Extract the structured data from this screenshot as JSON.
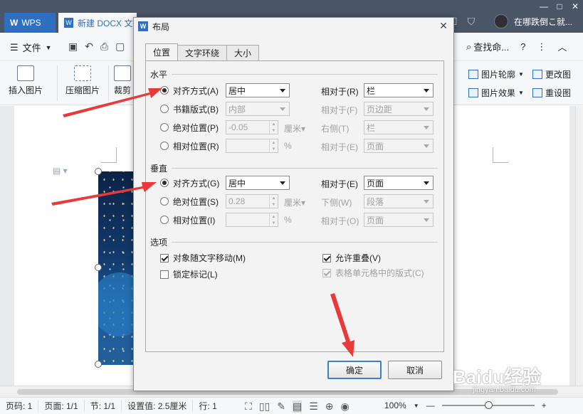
{
  "window": {
    "app_tab_label": "WPS",
    "doc_tab_label": "新建 DOCX 文",
    "user_name": "在哪跌倒こ就...",
    "controls": {
      "minimize": "—",
      "maximize": "□",
      "close": "✕"
    }
  },
  "menubar": {
    "file_label": "文件",
    "search_label": "查找命...",
    "help_label": "?",
    "more_label": "⋮",
    "collapse_label": "︿"
  },
  "ribbon": {
    "insert_picture": "插入图片",
    "compress_picture": "压缩图片",
    "crop": "裁剪",
    "picture_outline": "图片轮廓",
    "change_picture": "更改图",
    "picture_effects": "图片效果",
    "reset_picture": "重设图"
  },
  "statusbar": {
    "page_num": "页码: 1",
    "page": "页面: 1/1",
    "section": "节: 1/1",
    "position": "设置值: 2.5厘米",
    "line": "行: 1",
    "zoom": "100%",
    "zoom_minus": "—",
    "zoom_plus": "+"
  },
  "dialog": {
    "title": "布局",
    "tabs": [
      "位置",
      "文字环绕",
      "大小"
    ],
    "horizontal": {
      "heading": "水平",
      "rows": [
        {
          "label": "对齐方式(A)",
          "value": "居中",
          "rel_label": "相对于(R)",
          "rel_value": "栏",
          "checked": true
        },
        {
          "label": "书籍版式(B)",
          "value": "内部",
          "rel_label": "相对于(F)",
          "rel_value": "页边距",
          "checked": false
        },
        {
          "label": "绝对位置(P)",
          "value": "-0.05",
          "unit": "厘米▾",
          "rel_label": "右侧(T)",
          "rel_value": "栏",
          "checked": false
        },
        {
          "label": "相对位置(R)",
          "value": "",
          "unit": "%",
          "rel_label": "相对于(E)",
          "rel_value": "页面",
          "checked": false
        }
      ]
    },
    "vertical": {
      "heading": "垂直",
      "rows": [
        {
          "label": "对齐方式(G)",
          "value": "居中",
          "rel_label": "相对于(E)",
          "rel_value": "页面",
          "checked": true
        },
        {
          "label": "绝对位置(S)",
          "value": "0.28",
          "unit": "厘米▾",
          "rel_label": "下侧(W)",
          "rel_value": "段落",
          "checked": false
        },
        {
          "label": "相对位置(I)",
          "value": "",
          "unit": "%",
          "rel_label": "相对于(O)",
          "rel_value": "页面",
          "checked": false
        }
      ]
    },
    "options": {
      "heading": "选项",
      "move_with_text": "对象随文字移动(M)",
      "lock_anchor": "锁定标记(L)",
      "allow_overlap": "允许重叠(V)",
      "layout_in_cell": "表格单元格中的版式(C)"
    },
    "ok_label": "确定",
    "cancel_label": "取消"
  },
  "watermark": {
    "text": "Baidu经验",
    "sub": "jingyan.baidu.com"
  },
  "colors": {
    "accent": "#2f6fbf",
    "titlebar": "#4a5566",
    "arrow": "#e8393b"
  }
}
